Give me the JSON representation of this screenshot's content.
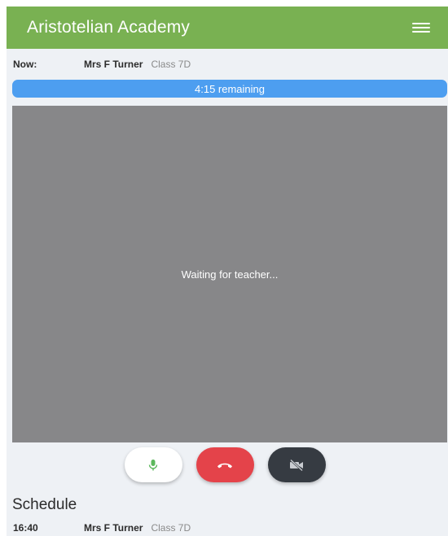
{
  "app": {
    "title": "Aristotelian Academy",
    "menu_icon": "hamburger-menu-icon",
    "brand_color": "#79b152"
  },
  "now": {
    "label": "Now:",
    "teacher": "Mrs F Turner",
    "class": "Class 7D"
  },
  "timer": {
    "remaining_text": "4:15 remaining",
    "progress_fraction": 1.0,
    "bar_color": "#4d9ef0"
  },
  "video": {
    "status_text": "Waiting for teacher..."
  },
  "controls": {
    "mic": {
      "icon": "microphone-icon",
      "color": "#5cb85c"
    },
    "hangup": {
      "icon": "phone-hangup-icon",
      "color": "#e4434a"
    },
    "camera": {
      "icon": "camera-off-icon",
      "color": "#363b42"
    }
  },
  "schedule": {
    "title": "Schedule",
    "items": [
      {
        "time": "16:40",
        "teacher": "Mrs F Turner",
        "class": "Class 7D"
      }
    ]
  }
}
